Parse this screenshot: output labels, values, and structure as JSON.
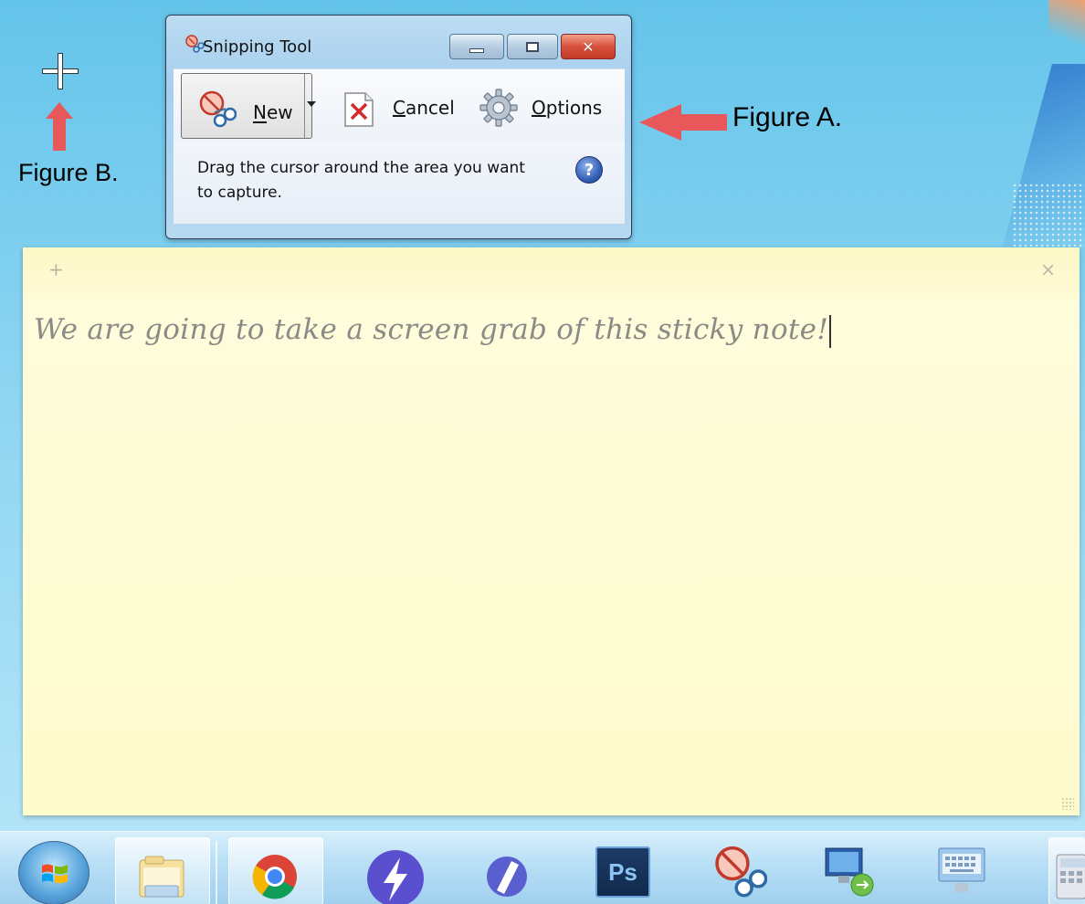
{
  "annotations": {
    "figure_a": "Figure A.",
    "figure_b": "Figure B."
  },
  "snipping_tool": {
    "title": "Snipping Tool",
    "new_label": "New",
    "cancel_label": "Cancel",
    "options_label": "Options",
    "hint": "Drag the cursor around the area you want to capture.",
    "help_glyph": "?"
  },
  "sticky_note": {
    "text": "We are going to take a screen grab of this sticky note!",
    "add_glyph": "+",
    "close_glyph": "×"
  },
  "taskbar": {
    "photoshop_label": "Ps",
    "items": [
      "start",
      "explorer",
      "chrome",
      "app-lightning",
      "app-slash",
      "photoshop",
      "snipping-tool",
      "remote-desktop",
      "onscreen-keyboard",
      "calculator"
    ]
  },
  "colors": {
    "arrow": "#e8585a",
    "sticky": "#fefcd6",
    "desktop": "#7fcff0"
  }
}
